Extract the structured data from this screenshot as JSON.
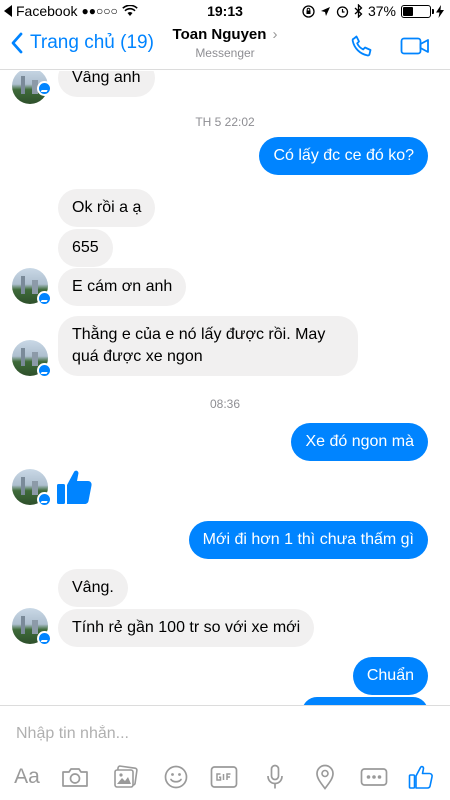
{
  "status_bar": {
    "app_back": "Facebook",
    "signal": "●●○○○",
    "time": "19:13",
    "battery_percent": "37%",
    "battery_level": 0.37
  },
  "nav": {
    "back_label": "Trang chủ (19)",
    "title": "Toan Nguyen",
    "subtitle": "Messenger"
  },
  "messages": {
    "m0": "Vâng anh",
    "ts1": "TH 5 22:02",
    "m1": "Có lấy đc ce đó ko?",
    "m2": "Ok rồi a ạ",
    "m3": "655",
    "m4": "E cám ơn anh",
    "m5_line1": "Thằng e của e nó lấy được rồi. May",
    "m5_line2": "quá được xe ngon",
    "ts2": "08:36",
    "m6": "Xe đó ngon mà",
    "m8": "Mới đi hơn 1 thì chưa thấm gì",
    "m9": "Vâng.",
    "m10": "Tính rẻ gần 100 tr so với xe mới",
    "m11": "Chuẩn"
  },
  "composer": {
    "placeholder": "Nhập tin nhắn...",
    "aa_label": "Aa"
  },
  "colors": {
    "accent": "#0084ff",
    "incoming_bubble": "#f1f0f0",
    "icon_gray": "#9a9a9a"
  },
  "icons": [
    "back-chevron-icon",
    "phone-icon",
    "video-icon",
    "thumbs-up-icon",
    "camera-icon",
    "gallery-icon",
    "sticker-icon",
    "gif-icon",
    "microphone-icon",
    "location-icon",
    "more-icon",
    "like-icon"
  ]
}
